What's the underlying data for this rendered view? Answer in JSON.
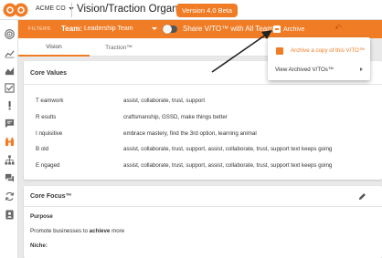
{
  "app": {
    "company": "ACME CO",
    "title": "Vision/Traction Organizer™",
    "version_badge": "Version 4.0 Beta",
    "brand_color": "#f07c26"
  },
  "sidebar": {
    "items": [
      {
        "icon": "target-icon",
        "active": false
      },
      {
        "icon": "line-chart-icon",
        "active": false
      },
      {
        "icon": "area-chart-icon",
        "active": false
      },
      {
        "icon": "checkbox-icon",
        "active": false
      },
      {
        "icon": "exclamation-icon",
        "active": false
      },
      {
        "icon": "chat-icon",
        "active": false
      },
      {
        "icon": "binoculars-icon",
        "active": true
      },
      {
        "icon": "org-chart-icon",
        "active": false
      },
      {
        "icon": "forum-icon",
        "active": false
      },
      {
        "icon": "sync-icon",
        "active": false
      },
      {
        "icon": "contacts-icon",
        "active": false
      }
    ]
  },
  "filterbar": {
    "filters_label": "FILTERS",
    "team_label": "Team:",
    "team_value": "Leadership Team",
    "share_label": "Share V/TO™ with All Teams",
    "share_enabled": false,
    "archive_label": "Archive",
    "undo_icon": "undo-icon"
  },
  "tabs": [
    {
      "label": "Vision",
      "active": true
    },
    {
      "label": "Traction™",
      "active": false
    }
  ],
  "core_values": {
    "title": "Core Values",
    "rows": [
      {
        "label": "T eamwork",
        "value": "assist, collaborate, trust, support"
      },
      {
        "label": "R esults",
        "value": "craftsmanship, GSSD, make things better"
      },
      {
        "label": "I nquisitive",
        "value": "embrace mastery, find the 3rd option, learning animal"
      },
      {
        "label": "B old",
        "value": "assist, collaborate, trust, support, assist, collaborate, trust, support text keeps going"
      },
      {
        "label": "E ngaged",
        "value": "assist, collaborate, trust, support, assist, collaborate, trust, support text keeps going"
      }
    ]
  },
  "core_focus": {
    "title": "Core Focus™",
    "purpose_label": "Purpose",
    "purpose_text_before": "Promote businesses to ",
    "purpose_text_bold": "achieve",
    "purpose_text_after": " more",
    "niche_label": "Niche:"
  },
  "archive_menu": {
    "items": [
      {
        "label": "Archive a copy of this V/TO™",
        "highlighted": true
      },
      {
        "label": "View Archived V/TOs™",
        "has_submenu": true
      }
    ]
  }
}
